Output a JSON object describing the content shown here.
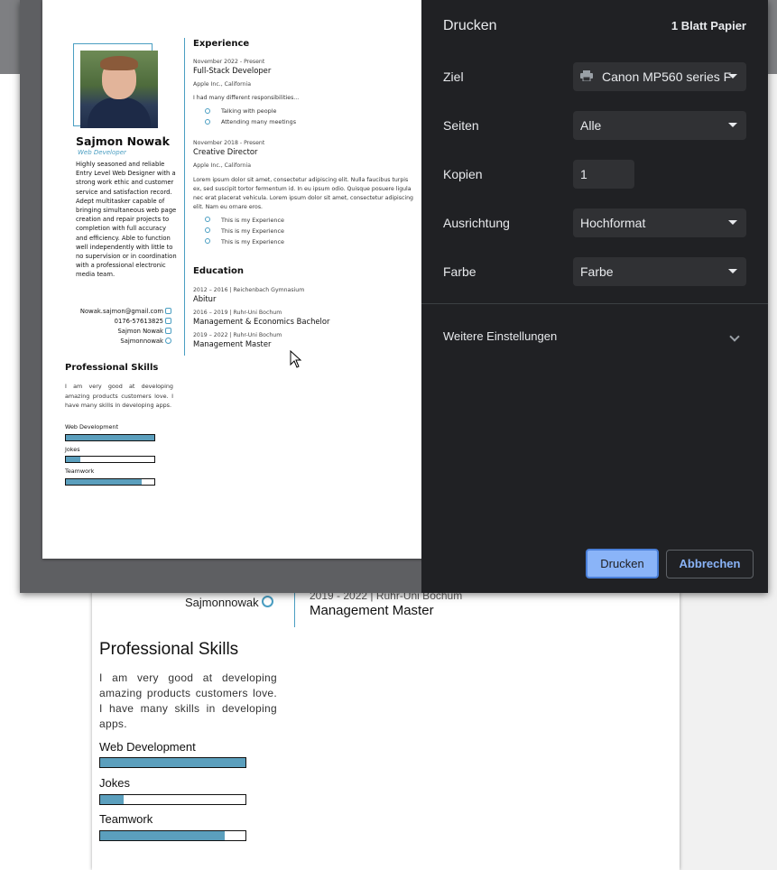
{
  "background_resume": {
    "contact_github": "Sajmonnowak",
    "edu_meta": "2019 - 2022  |  Ruhr-Uni Bochum",
    "edu_degree": "Management Master",
    "skills_heading": "Professional Skills",
    "skills_text": "I am very good at developing amazing products customers love. I have many skills in developing apps.",
    "skills": [
      {
        "name": "Web Development",
        "level": 1.0
      },
      {
        "name": "Jokes",
        "level": 0.16
      },
      {
        "name": "Teamwork",
        "level": 0.86
      }
    ]
  },
  "preview": {
    "name": "Sajmon Nowak",
    "role": "Web Developer",
    "bio": "Highly seasoned and reliable Entry Level Web Designer with a strong work ethic and customer service and satisfaction record. Adept multitasker capable of bringing simultaneous web page creation and repair projects to completion with full accuracy and efficiency. Able to function well independently with little to no supervision or in coordination with a professional electronic media team.",
    "contacts": [
      "Nowak.sajmon@gmail.com",
      "0176-57613825",
      "Sajmon Nowak",
      "Sajmonnowak"
    ],
    "experience_heading": "Experience",
    "jobs": [
      {
        "date": "November 2022 - Present",
        "title": "Full-Stack Developer",
        "company": "Apple Inc., California",
        "text": "I had many different responsibilities...",
        "bullets": [
          "Talking with people",
          "Attending many meetings"
        ]
      },
      {
        "date": "November 2018 - Present",
        "title": "Creative Director",
        "company": "Apple Inc., California",
        "text": "Lorem ipsum dolor sit amet, consectetur adipiscing elit. Nulla faucibus turpis ex, sed suscipit tortor fermentum id. In eu ipsum odio. Quisque posuere ligula nec erat placerat vehicula. Lorem ipsum dolor sit amet, consectetur adipiscing elit. Nam eu ornare eros.",
        "bullets": [
          "This is my Experience",
          "This is my Experience",
          "This is my Experience"
        ]
      }
    ],
    "education_heading": "Education",
    "education": [
      {
        "meta": "2012 – 2016  |  Reichenbach Gymnasium",
        "degree": "Abitur"
      },
      {
        "meta": "2016 – 2019  |  Ruhr-Uni Bochum",
        "degree": "Management & Economics Bachelor"
      },
      {
        "meta": "2019 – 2022  |  Ruhr-Uni Bochum",
        "degree": "Management Master"
      }
    ],
    "skills_heading": "Professional Skills",
    "skills_text": "I am very good at developing amazing products customers love. I have many skills in developing apps.",
    "skills": [
      {
        "name": "Web Development",
        "level": 1.0
      },
      {
        "name": "Jokes",
        "level": 0.16
      },
      {
        "name": "Teamwork",
        "level": 0.86
      }
    ]
  },
  "print_dialog": {
    "title": "Drucken",
    "sheet_count": "1 Blatt Papier",
    "destination_label": "Ziel",
    "destination_value": "Canon MP560 series F",
    "pages_label": "Seiten",
    "pages_value": "Alle",
    "copies_label": "Kopien",
    "copies_value": "1",
    "orientation_label": "Ausrichtung",
    "orientation_value": "Hochformat",
    "color_label": "Farbe",
    "color_value": "Farbe",
    "more_settings": "Weitere Einstellungen",
    "print_button": "Drucken",
    "cancel_button": "Abbrechen"
  },
  "colors": {
    "accent": "#4a9ec2",
    "skill_fill": "#5b9fbd",
    "dialog_bg": "#202124",
    "primary_button": "#8ab4f8"
  }
}
